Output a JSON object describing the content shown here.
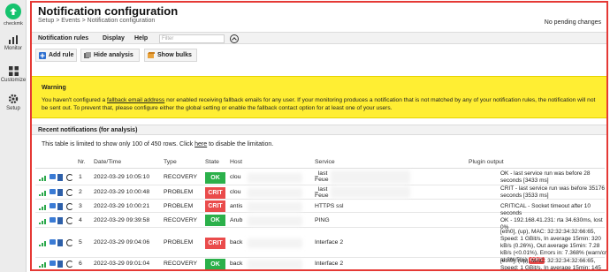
{
  "sidebar": {
    "logo_label": "checkmk",
    "items": [
      {
        "label": "Monitor",
        "icon": "monitor-icon"
      },
      {
        "label": "Customize",
        "icon": "customize-icon"
      },
      {
        "label": "Setup",
        "icon": "gear-icon"
      }
    ]
  },
  "page": {
    "title": "Notification configuration",
    "breadcrumb": "Setup > Events > Notification configuration",
    "pending": "No pending changes"
  },
  "menubar": {
    "items": [
      "Notification rules",
      "Display",
      "Help"
    ],
    "filter_placeholder": "Filter"
  },
  "toolbar": {
    "add_rule": "Add rule",
    "hide_analysis": "Hide analysis",
    "show_bulks": "Show bulks"
  },
  "warning": {
    "title": "Warning",
    "text_before": "You haven't configured a ",
    "link": "fallback email address",
    "text_after": " nor enabled receiving fallback emails for any user. If your monitoring produces a notification that is not matched by any of your notification rules, the notification will not be sent out. To prevent that, please configure either the global setting or enable the fallback contact option for at least one of your users."
  },
  "recent": {
    "title": "Recent notifications (for analysis)",
    "limit_before": "This table is limited to show only 100 of 450 rows. Click ",
    "limit_link": "here",
    "limit_after": " to disable the limitation.",
    "columns": [
      "Nr.",
      "Date/Time",
      "Type",
      "State",
      "Host",
      "Service",
      "Plugin output"
    ],
    "rows": [
      {
        "nr": "1",
        "datetime": "2022-03-29 10:05:10",
        "type": "RECOVERY",
        "state": "OK",
        "host": "clou",
        "service": "_last\nFeue",
        "output": "OK - last service run was before 28 seconds [3433 ms]"
      },
      {
        "nr": "2",
        "datetime": "2022-03-29 10:00:48",
        "type": "PROBLEM",
        "state": "CRIT",
        "host": "clou",
        "service": "_last\nFeue",
        "output": "CRIT - last service run was before 35176 seconds [3533 ms]"
      },
      {
        "nr": "3",
        "datetime": "2022-03-29 10:00:21",
        "type": "PROBLEM",
        "state": "CRIT",
        "host": "antis",
        "service": "HTTPS ssl",
        "output": "CRITICAL - Socket timeout after 10 seconds"
      },
      {
        "nr": "4",
        "datetime": "2022-03-29 09:39:58",
        "type": "RECOVERY",
        "state": "OK",
        "host": "Arub",
        "service": "PING",
        "output": "OK - 192.168.41.231: rta 34.630ms, lost 0%"
      },
      {
        "nr": "5",
        "datetime": "2022-03-29 09:04:06",
        "type": "PROBLEM",
        "state": "CRIT",
        "host": "back",
        "service": "Interface 2",
        "output": "[eth0], (up), MAC: 32:32:34:32:66:65, Speed: 1 GBit/s, In average 15min: 320 kB/s (0.26%), Out average 15min: 7.28 kB/s (<0.01%), Errors in: 7.368% (warn/crit at 3%/5%)",
        "output_badge": "CRIT"
      },
      {
        "nr": "6",
        "datetime": "2022-03-29 09:01:04",
        "type": "RECOVERY",
        "state": "OK",
        "host": "back",
        "service": "Interface 2",
        "output": "[eth0], (up), MAC: 32:32:34:32:66:65, Speed: 1 GBit/s, In average 15min: 145 kB/s (0.12%), Out"
      }
    ]
  },
  "colors": {
    "accent": "#15c36e",
    "ok": "#2bb04a",
    "crit": "#ea4b4b",
    "warning_bg": "#ffee33",
    "frame": "#e53935"
  }
}
